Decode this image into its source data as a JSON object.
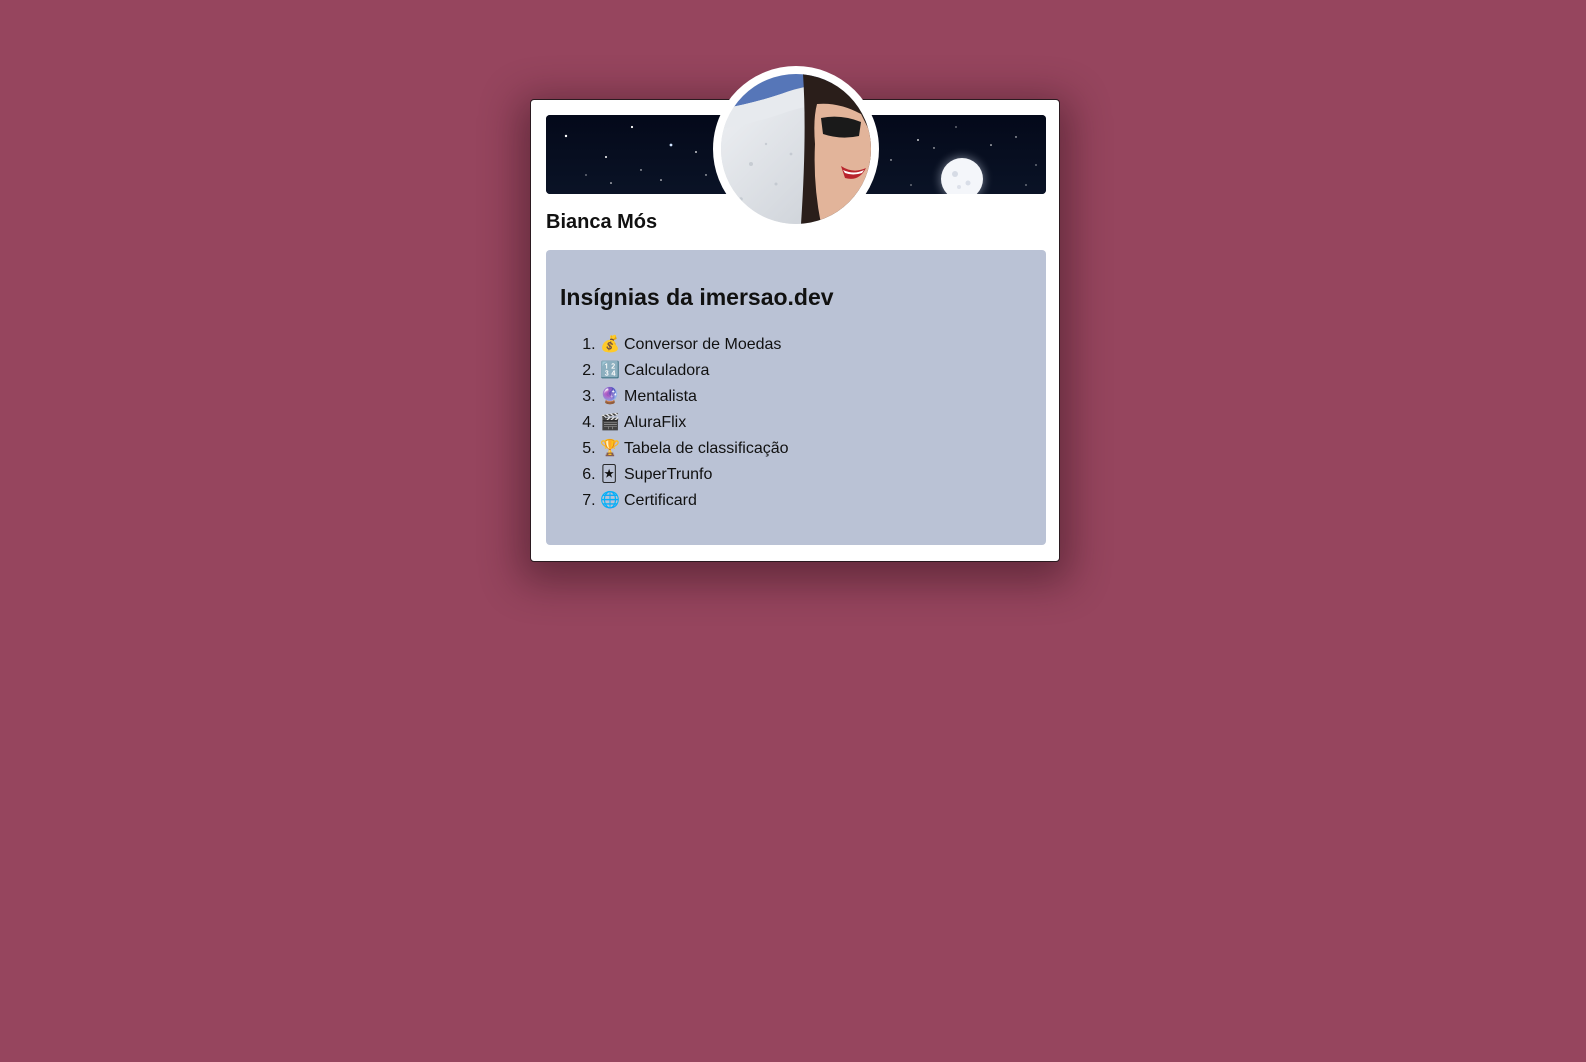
{
  "profile": {
    "name": "Bianca Mós",
    "avatar_icon": "profile-photo"
  },
  "badges": {
    "title": "Insígnias da imersao.dev",
    "items": [
      {
        "icon": "💰",
        "label": "Conversor de Moedas"
      },
      {
        "icon": "🔢",
        "label": "Calculadora"
      },
      {
        "icon": "🔮",
        "label": "Mentalista"
      },
      {
        "icon": "🎬",
        "label": "AluraFlix"
      },
      {
        "icon": "🏆",
        "label": "Tabela de classificação"
      },
      {
        "icon": "🃏",
        "label": "SuperTrunfo"
      },
      {
        "icon": "🌐",
        "label": "Certificard"
      }
    ]
  },
  "colors": {
    "page_background": "#96455e",
    "card_background": "#ffffff",
    "badges_background": "#bac2d5",
    "banner_background": "#050b1a"
  }
}
